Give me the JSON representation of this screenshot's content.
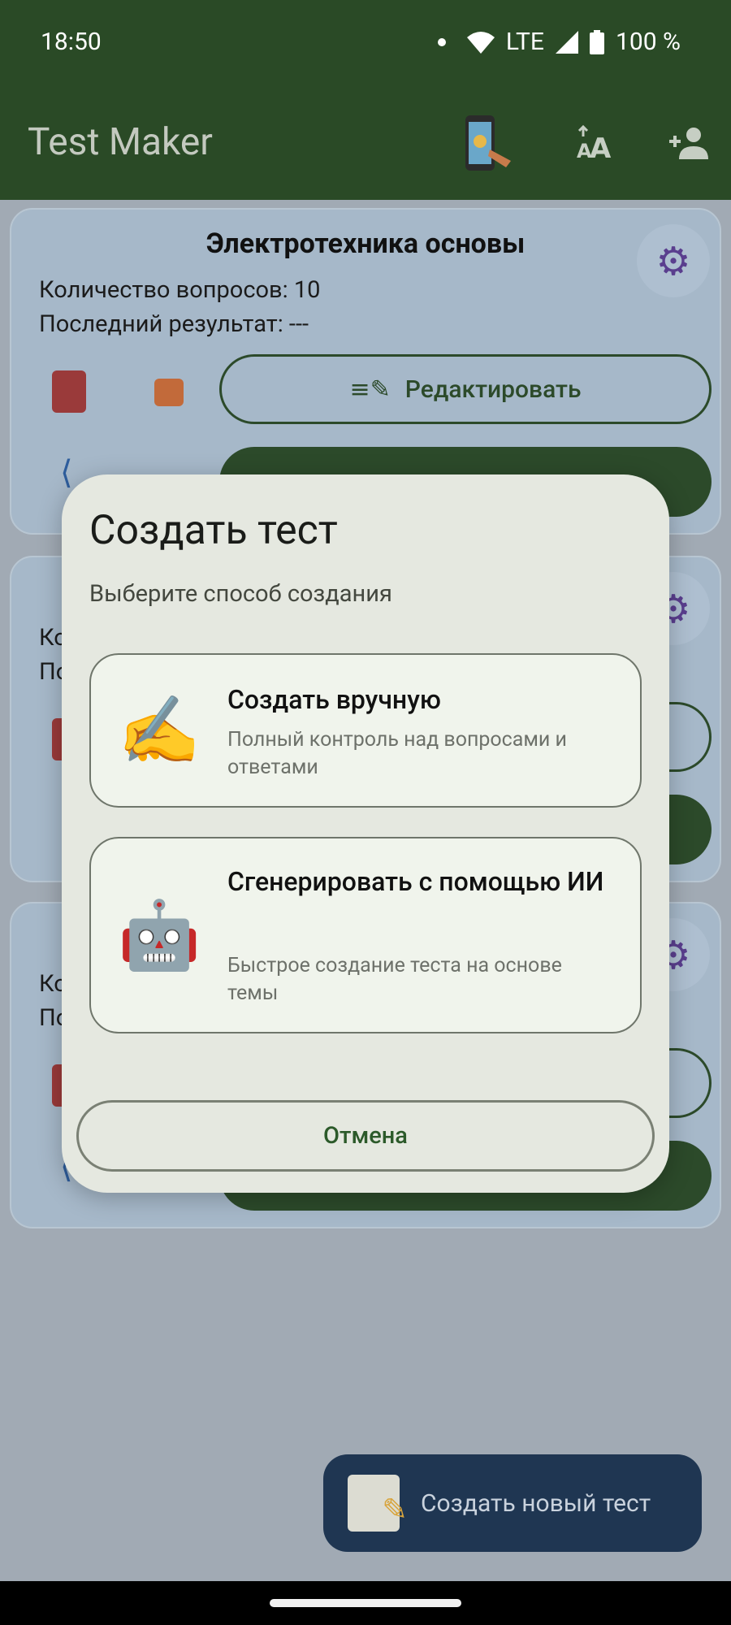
{
  "status_bar": {
    "time": "18:50",
    "network": "LTE",
    "battery": "100 %"
  },
  "app_bar": {
    "title": "Test Maker",
    "icons": [
      "phone-quiz-icon",
      "text-size-icon",
      "add-user-icon"
    ]
  },
  "tests": [
    {
      "name": "Электротехника основы",
      "questions_label": "Количество вопросов: 10",
      "last_result_label": "Последний результат:  ---",
      "edit_label": "Редактировать"
    },
    {
      "name": "",
      "questions_label": "Ко",
      "last_result_label": "По"
    },
    {
      "name": "",
      "questions_label": "Ко",
      "last_result_label": "По"
    }
  ],
  "fab": {
    "label": "Создать новый тест"
  },
  "dialog": {
    "title": "Создать тест",
    "subtitle": "Выберите способ создания",
    "options": [
      {
        "emoji": "✍️",
        "title": "Создать вручную",
        "description": "Полный контроль над вопросами и ответами"
      },
      {
        "emoji": "🤖",
        "title": "Сгенерировать с помощью ИИ",
        "description": "Быстрое создание теста на основе темы"
      }
    ],
    "cancel_label": "Отмена"
  },
  "colors": {
    "app_bar": "#2a4a26",
    "scrim": "#a1aab4",
    "dialog_bg": "#e5e8e0",
    "fab_bg": "#1f3652",
    "accent_green": "#2c4a2a"
  }
}
